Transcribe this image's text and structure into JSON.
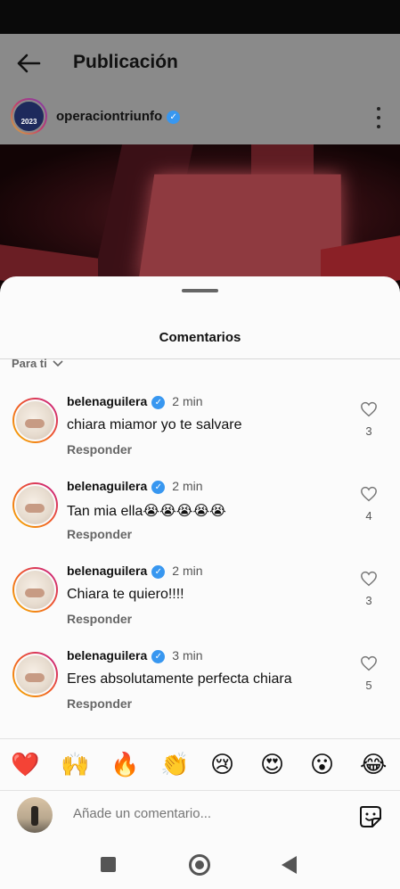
{
  "header": {
    "title": "Publicación",
    "back_icon": "arrow-left-icon"
  },
  "post": {
    "author": "operaciontriunfo",
    "author_avatar_text": "2023",
    "verified": true
  },
  "comments_sheet": {
    "title": "Comentarios",
    "filter_label": "Para ti",
    "comments": [
      {
        "username": "belenaguilera",
        "time": "2 min",
        "text": "chiara miamor yo te salvare",
        "reply_label": "Responder",
        "likes": "3"
      },
      {
        "username": "belenaguilera",
        "time": "2 min",
        "text": "Tan mia ella😭😭😭😭😭",
        "reply_label": "Responder",
        "likes": "4"
      },
      {
        "username": "belenaguilera",
        "time": "2 min",
        "text": "Chiara te quiero!!!!",
        "reply_label": "Responder",
        "likes": "3"
      },
      {
        "username": "belenaguilera",
        "time": "3 min",
        "text": "Eres absolutamente perfecta chiara",
        "reply_label": "Responder",
        "likes": "5"
      }
    ]
  },
  "emoji_bar": [
    "❤️",
    "🙌",
    "🔥",
    "👏",
    "😢",
    "😍",
    "😮",
    "😂"
  ],
  "comment_input": {
    "placeholder": "Añade un comentario..."
  },
  "colors": {
    "verified_blue": "#3897f0",
    "sheet_background": "#fbfbfb",
    "header_dim": "#8a8a8a"
  }
}
